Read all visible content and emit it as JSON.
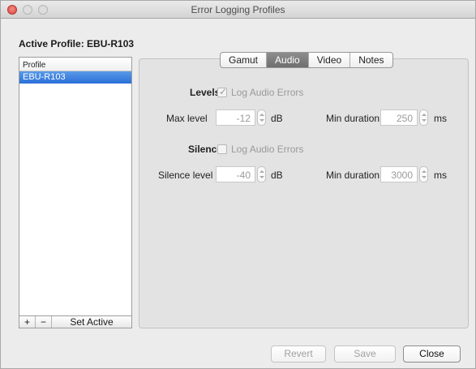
{
  "window": {
    "title": "Error Logging Profiles"
  },
  "active_profile": "Active Profile: EBU-R103",
  "profile_list": {
    "header": "Profile",
    "items": [
      "EBU-R103"
    ],
    "selected": "EBU-R103",
    "add_label": "+",
    "remove_label": "−",
    "set_active_label": "Set Active"
  },
  "tabs": [
    {
      "label": "Gamut",
      "active": false
    },
    {
      "label": "Audio",
      "active": true
    },
    {
      "label": "Video",
      "active": false
    },
    {
      "label": "Notes",
      "active": false
    }
  ],
  "audio": {
    "levels": {
      "heading": "Levels",
      "log_label": "Log Audio Errors",
      "log_checked": true,
      "max_level_label": "Max level",
      "max_level_value": "-12",
      "max_level_unit": "dB",
      "min_duration_label": "Min duration",
      "min_duration_value": "250",
      "min_duration_unit": "ms"
    },
    "silence": {
      "heading": "Silence",
      "log_label": "Log Audio Errors",
      "log_checked": false,
      "silence_level_label": "Silence level",
      "silence_level_value": "-40",
      "silence_level_unit": "dB",
      "min_duration_label": "Min duration",
      "min_duration_value": "3000",
      "min_duration_unit": "ms"
    }
  },
  "footer": {
    "revert_label": "Revert",
    "save_label": "Save",
    "close_label": "Close"
  }
}
